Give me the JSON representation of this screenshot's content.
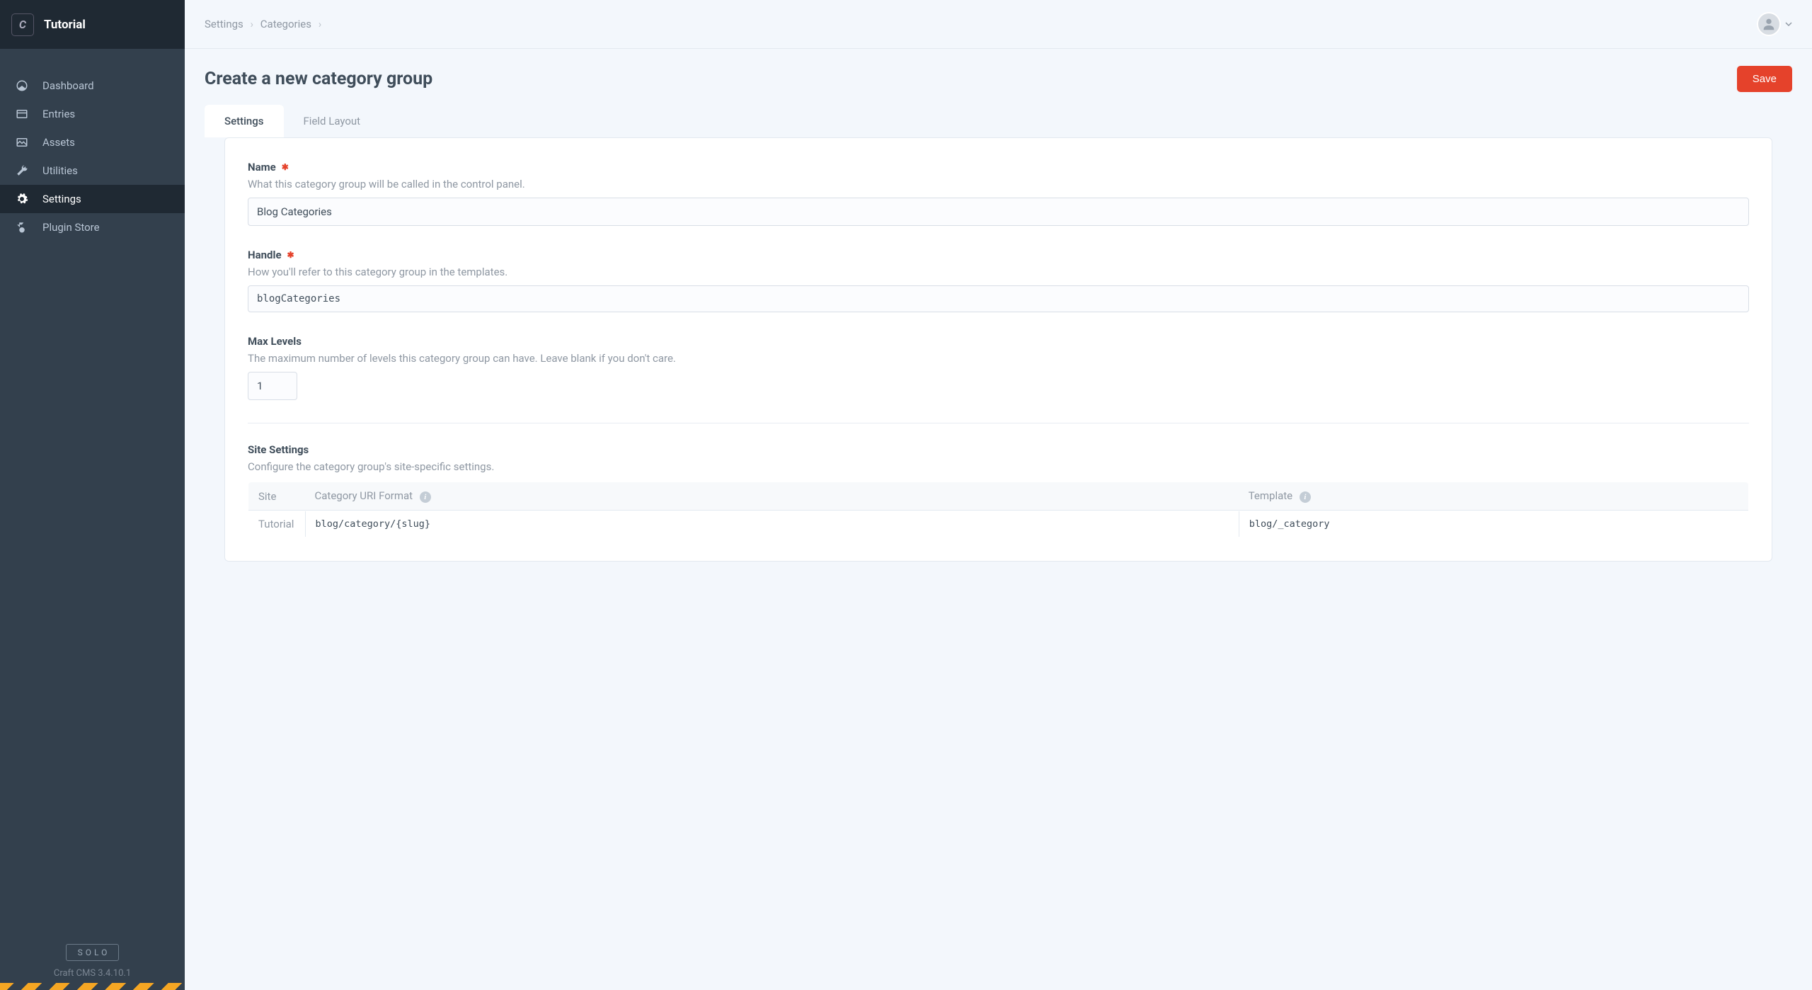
{
  "header": {
    "logo_letter": "C",
    "site_name": "Tutorial"
  },
  "sidebar": {
    "items": [
      {
        "label": "Dashboard",
        "icon": "dashboard-icon"
      },
      {
        "label": "Entries",
        "icon": "entries-icon"
      },
      {
        "label": "Assets",
        "icon": "assets-icon"
      },
      {
        "label": "Utilities",
        "icon": "utilities-icon"
      },
      {
        "label": "Settings",
        "icon": "settings-icon",
        "active": true
      },
      {
        "label": "Plugin Store",
        "icon": "plugin-store-icon"
      }
    ],
    "edition_badge": "SOLO",
    "version": "Craft CMS 3.4.10.1"
  },
  "breadcrumbs": {
    "items": [
      {
        "label": "Settings"
      },
      {
        "label": "Categories"
      }
    ]
  },
  "page": {
    "title": "Create a new category group",
    "save_label": "Save"
  },
  "tabs": [
    {
      "label": "Settings",
      "active": true
    },
    {
      "label": "Field Layout"
    }
  ],
  "fields": {
    "name": {
      "label": "Name",
      "required": true,
      "help": "What this category group will be called in the control panel.",
      "value": "Blog Categories"
    },
    "handle": {
      "label": "Handle",
      "required": true,
      "help": "How you'll refer to this category group in the templates.",
      "value": "blogCategories"
    },
    "maxLevels": {
      "label": "Max Levels",
      "help": "The maximum number of levels this category group can have. Leave blank if you don't care.",
      "value": "1"
    },
    "siteSettings": {
      "label": "Site Settings",
      "help": "Configure the category group's site-specific settings.",
      "columns": {
        "site": "Site",
        "uriFormat": "Category URI Format",
        "template": "Template"
      },
      "rows": [
        {
          "site": "Tutorial",
          "uriFormat": "blog/category/{slug}",
          "template": "blog/_category"
        }
      ]
    }
  }
}
